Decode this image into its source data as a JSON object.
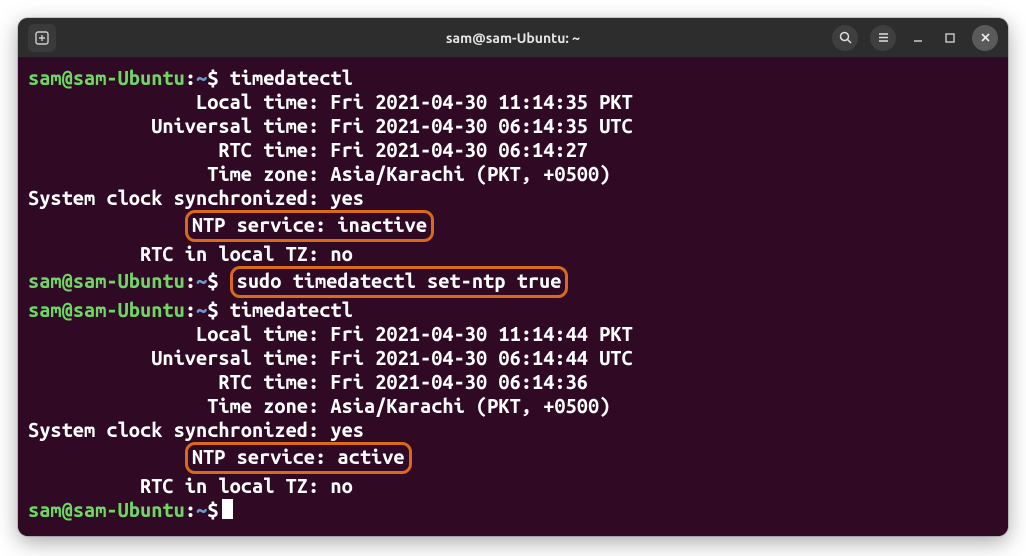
{
  "window": {
    "title": "sam@sam-Ubuntu: ~"
  },
  "prompt": {
    "user": "sam",
    "host": "sam-Ubuntu",
    "path": "~",
    "sigil": "$"
  },
  "commands": {
    "cmd1": "timedatectl",
    "cmd2": "sudo timedatectl set-ntp true",
    "cmd3": "timedatectl"
  },
  "output1": {
    "local_time_label": "               Local time:",
    "local_time_value": " Fri 2021-04-30 11:14:35 PKT",
    "universal_label": "           Universal time:",
    "universal_value": " Fri 2021-04-30 06:14:35 UTC",
    "rtc_label": "                 RTC time:",
    "rtc_value": " Fri 2021-04-30 06:14:27",
    "tz_label": "                Time zone:",
    "tz_value": " Asia/Karachi (PKT, +0500)",
    "sync_label": "System clock synchronized:",
    "sync_value": " yes",
    "ntp_pad": "              ",
    "ntp_label": "NTP service:",
    "ntp_value": " inactive",
    "rtc_local_label": "          RTC in local TZ:",
    "rtc_local_value": " no"
  },
  "output2": {
    "local_time_label": "               Local time:",
    "local_time_value": " Fri 2021-04-30 11:14:44 PKT",
    "universal_label": "           Universal time:",
    "universal_value": " Fri 2021-04-30 06:14:44 UTC",
    "rtc_label": "                 RTC time:",
    "rtc_value": " Fri 2021-04-30 06:14:36",
    "tz_label": "                Time zone:",
    "tz_value": " Asia/Karachi (PKT, +0500)",
    "sync_label": "System clock synchronized:",
    "sync_value": " yes",
    "ntp_pad": "              ",
    "ntp_label": "NTP service:",
    "ntp_value": " active",
    "rtc_local_label": "          RTC in local TZ:",
    "rtc_local_value": " no"
  }
}
